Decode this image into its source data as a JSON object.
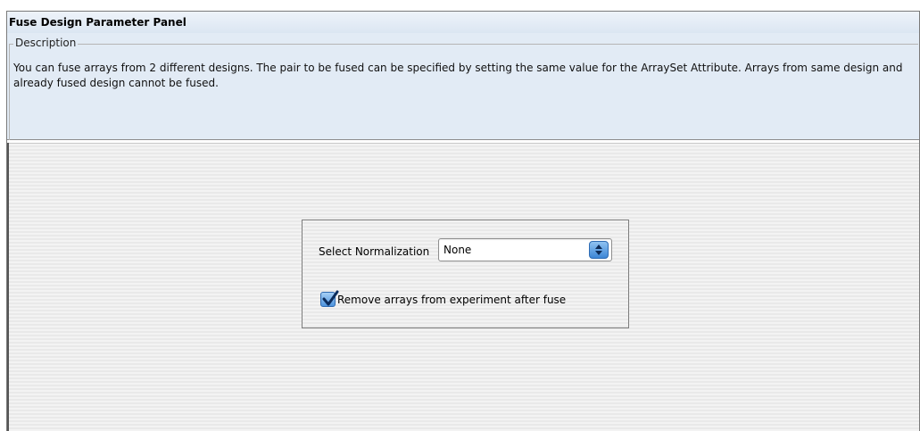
{
  "panel": {
    "title": "Fuse Design Parameter Panel"
  },
  "description": {
    "legend": "Description",
    "text": "You can fuse arrays from 2 different designs. The pair to be fused can be specified by setting the same value for the ArraySet Attribute. Arrays from same design and already fused design cannot be fused."
  },
  "options": {
    "normalization_label": "Select Normalization",
    "normalization_value": "None",
    "remove_arrays_label": "Remove arrays from experiment after fuse",
    "remove_arrays_checked": true
  },
  "icons": {
    "select_arrow": "updown-arrow-icon",
    "checkbox_mark": "checkmark-icon"
  },
  "colors": {
    "header_bg": "#e2ebf5",
    "accent": "#3d86d6",
    "content_stripe_light": "#f3f3f3",
    "content_stripe_dark": "#e9e9e9"
  }
}
